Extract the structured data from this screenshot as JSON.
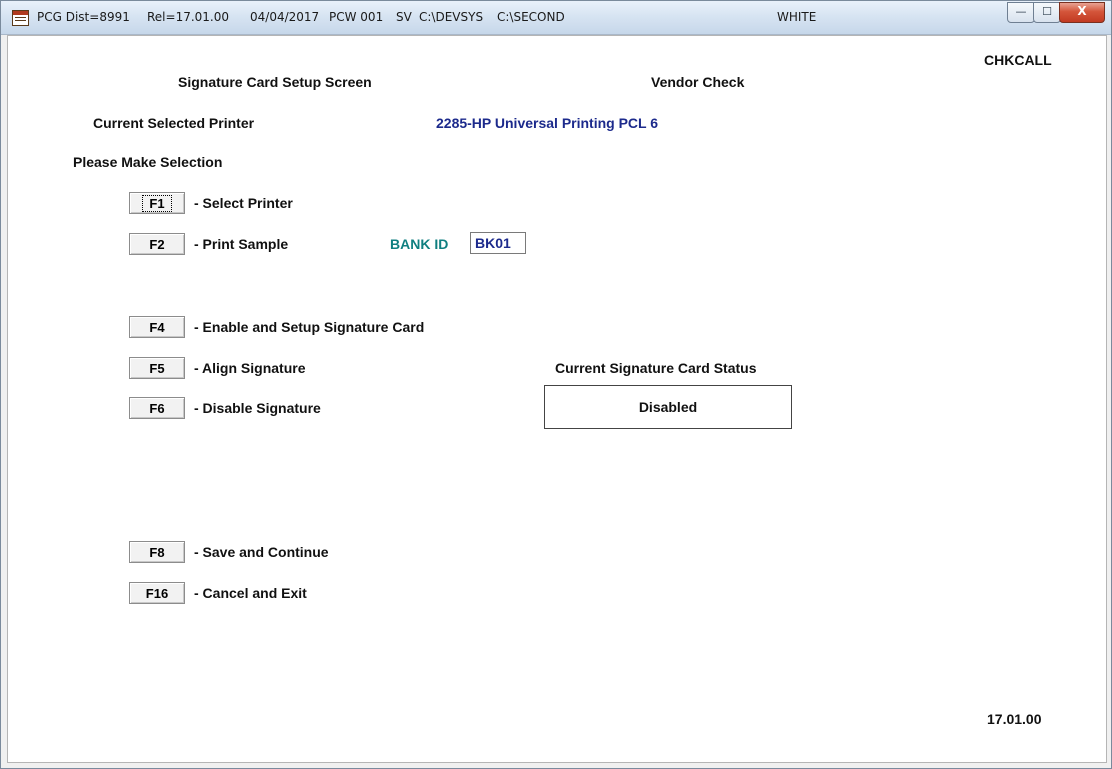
{
  "window": {
    "title_segments": [
      "PCG Dist=8991",
      "Rel=17.01.00",
      "04/04/2017",
      "PCW 001",
      "SV",
      "C:\\DEVSYS",
      "C:\\SECOND",
      "WHITE"
    ],
    "controls": {
      "minimize": "—",
      "maximize": "☐",
      "close": "X"
    }
  },
  "screen": {
    "program_id": "CHKCALL",
    "heading": "Signature Card Setup Screen",
    "subheading": "Vendor Check",
    "printer_label": "Current Selected Printer",
    "printer_value": "2285-HP Universal Printing PCL 6",
    "selection_prompt": "Please Make Selection",
    "bank_id_label": "BANK ID",
    "bank_id_value": "BK01",
    "status_label": "Current Signature Card Status",
    "status_value": "Disabled",
    "version": "17.01.00"
  },
  "menu": [
    {
      "key": "F1",
      "desc": "- Select Printer"
    },
    {
      "key": "F2",
      "desc": "- Print Sample"
    },
    {
      "key": "F4",
      "desc": "- Enable and Setup Signature Card"
    },
    {
      "key": "F5",
      "desc": "- Align Signature"
    },
    {
      "key": "F6",
      "desc": "- Disable Signature"
    },
    {
      "key": "F8",
      "desc": "- Save and Continue"
    },
    {
      "key": "F16",
      "desc": "- Cancel and Exit"
    }
  ],
  "colors": {
    "accent_teal": "#0f7f80",
    "accent_navy": "#1c2a8c"
  }
}
